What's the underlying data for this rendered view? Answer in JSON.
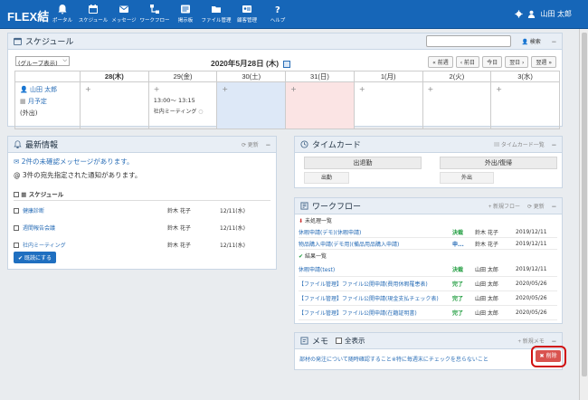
{
  "topbar": {
    "logo": "FLEX結",
    "nav": [
      {
        "label": "ポータル",
        "icon": "bell-icon"
      },
      {
        "label": "スケジュール",
        "icon": "calendar-icon"
      },
      {
        "label": "メッセージ",
        "icon": "envelope-icon"
      },
      {
        "label": "ワークフロー",
        "icon": "workflow-icon"
      },
      {
        "label": "掲示板",
        "icon": "bulletin-icon"
      },
      {
        "label": "ファイル管理",
        "icon": "folder-icon"
      },
      {
        "label": "顧客管理",
        "icon": "customer-icon"
      },
      {
        "label": "ヘルプ",
        "icon": "help-icon"
      }
    ],
    "user": "山田 太郎"
  },
  "schedule": {
    "title": "スケジュール",
    "search_label": "検索",
    "group_select": "(グループ表示)",
    "date_title": "2020年5月28日 (木)",
    "nav_buttons": [
      "前週",
      "前日",
      "今日",
      "翌日",
      "翌週"
    ],
    "days": [
      "28(木)",
      "29(金)",
      "30(土)",
      "31(日)",
      "1(月)",
      "2(火)",
      "3(水)"
    ],
    "user_name": "山田 太郎",
    "user_link": "月予定",
    "user_status": "(外出)",
    "event_time": "13:00～ 13:15",
    "event_title": "社内ミーティング"
  },
  "news": {
    "title": "最新情報",
    "refresh": "更新",
    "unread_msg": "2件の未確認メッセージがあります。",
    "notice_msg": "3件の宛先指定された通知があります。",
    "section": "スケジュール",
    "rows": [
      {
        "title": "健康診断",
        "person": "鈴木 花子",
        "date": "12/11(水)"
      },
      {
        "title": "週間報告会議",
        "person": "鈴木 花子",
        "date": "12/11(水)"
      },
      {
        "title": "社内ミーティング",
        "person": "鈴木 花子",
        "date": "12/11(水)"
      }
    ],
    "mark_read": "既読にする"
  },
  "timecard": {
    "title": "タイムカード",
    "list_label": "タイムカード一覧",
    "buttons": [
      "出退勤",
      "外出/復帰"
    ],
    "sub": [
      "出勤",
      "外出"
    ]
  },
  "workflow": {
    "title": "ワークフロー",
    "new_label": "新規フロー",
    "refresh": "更新",
    "pending_title": "未処理一覧",
    "pending": [
      {
        "title": "休暇申請(デモ)(休暇申請)",
        "status": "決裁",
        "person": "鈴木 花子",
        "date": "2019/12/11"
      },
      {
        "title": "物品購入申請(デモ用)(備品用品購入申請)",
        "status": "申...",
        "person": "鈴木 花子",
        "date": "2019/12/11"
      }
    ],
    "done_title": "結果一覧",
    "done": [
      {
        "title": "休暇申請(test)",
        "status": "決裁",
        "person": "山田 太郎",
        "date": "2019/12/11"
      },
      {
        "title": "【ファイル管理】ファイル公開申請(費用休暇罹患表)",
        "status": "完了",
        "person": "山田 太郎",
        "date": "2020/05/26"
      },
      {
        "title": "【ファイル管理】ファイル公開申請(現金支払チェック表)",
        "status": "完了",
        "person": "山田 太郎",
        "date": "2020/05/26"
      },
      {
        "title": "【ファイル管理】ファイル公開申請(在籍証明書)",
        "status": "完了",
        "person": "山田 太郎",
        "date": "2020/05/26"
      }
    ]
  },
  "memo": {
    "title": "メモ",
    "show_all": "全表示",
    "new_label": "新規メモ",
    "text": "部材の発注について随時確認すること※特に毎週末にチェックを怠らないこと",
    "delete": "削除"
  }
}
